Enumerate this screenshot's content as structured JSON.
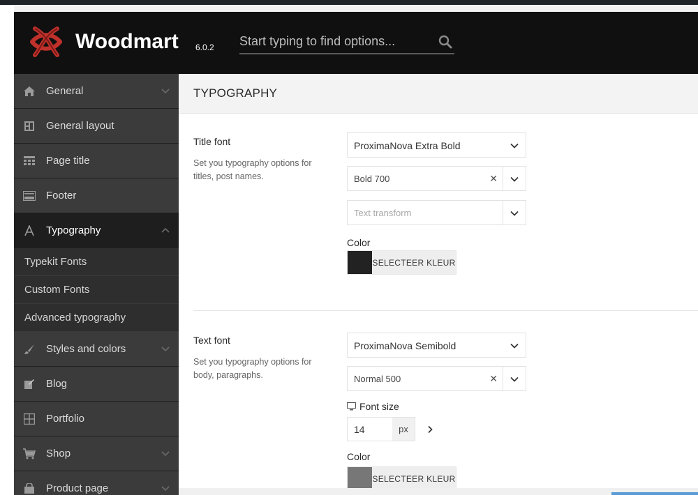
{
  "header": {
    "brand": "Woodmart",
    "version": "6.0.2",
    "search_placeholder": "Start typing to find options..."
  },
  "sidebar": {
    "items": [
      {
        "label": "General",
        "icon": "home-icon",
        "has_chevron": true
      },
      {
        "label": "General layout",
        "icon": "layout-icon",
        "has_chevron": false
      },
      {
        "label": "Page title",
        "icon": "page-title-icon",
        "has_chevron": false
      },
      {
        "label": "Footer",
        "icon": "footer-icon",
        "has_chevron": false
      },
      {
        "label": "Typography",
        "icon": "typography-icon",
        "has_chevron": true,
        "active": true
      },
      {
        "label": "Styles and colors",
        "icon": "brush-icon",
        "has_chevron": true
      },
      {
        "label": "Blog",
        "icon": "edit-icon",
        "has_chevron": false
      },
      {
        "label": "Portfolio",
        "icon": "grid-icon",
        "has_chevron": false
      },
      {
        "label": "Shop",
        "icon": "cart-icon",
        "has_chevron": true
      },
      {
        "label": "Product page",
        "icon": "product-icon",
        "has_chevron": true
      }
    ],
    "sub_items": [
      "Typekit Fonts",
      "Custom Fonts",
      "Advanced typography"
    ]
  },
  "main": {
    "page_title": "TYPOGRAPHY",
    "title_font": {
      "label": "Title font",
      "description": "Set you typography options for titles, post names.",
      "family": "ProximaNova Extra Bold",
      "weight": "Bold 700",
      "transform_placeholder": "Text transform",
      "color_label": "Color",
      "color_button": "SELECTEER KLEUR",
      "color_value": "#222222"
    },
    "text_font": {
      "label": "Text font",
      "description": "Set you typography options for body, paragraphs.",
      "family": "ProximaNova Semibold",
      "weight": "Normal 500",
      "font_size_label": "Font size",
      "font_size_value": "14",
      "font_size_unit": "px",
      "color_label": "Color",
      "color_button": "SELECTEER KLEUR",
      "color_value": "#777777"
    }
  },
  "colors": {
    "accent_logo": "#c0312b",
    "sidebar_bg": "#3b3b3b",
    "header_bg": "#101010"
  }
}
